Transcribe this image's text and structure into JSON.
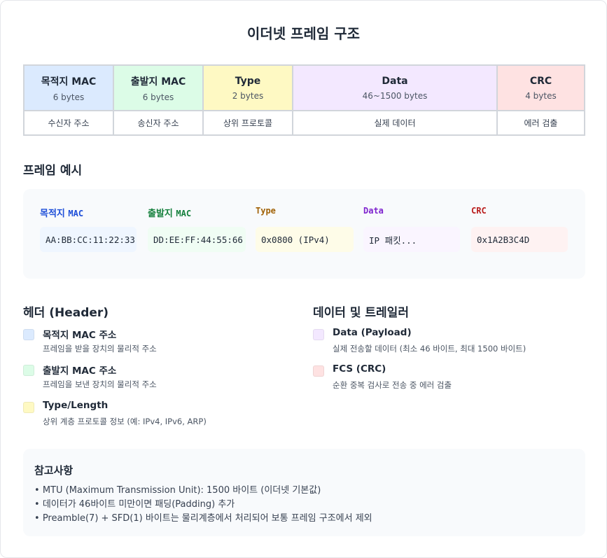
{
  "title": "이더넷 프레임 구조",
  "frame": [
    {
      "name": "목적지 MAC",
      "size": "6 bytes",
      "desc": "수신자 주소",
      "color": "#dbeafe"
    },
    {
      "name": "출발지 MAC",
      "size": "6 bytes",
      "desc": "송신자 주소",
      "color": "#dcfce7"
    },
    {
      "name": "Type",
      "size": "2 bytes",
      "desc": "상위 프로토콜",
      "color": "#fef9c3"
    },
    {
      "name": "Data",
      "size": "46~1500 bytes",
      "desc": "실제 데이터",
      "color": "#f3e8ff"
    },
    {
      "name": "CRC",
      "size": "4 bytes",
      "desc": "에러 검출",
      "color": "#fee2e2"
    }
  ],
  "example": {
    "title": "프레임 예시",
    "fields": [
      {
        "label": "목적지",
        "label_mono": "MAC",
        "value": "AA:BB:CC:11:22:33",
        "label_color": "#1d4ed8",
        "bg": "#eff6ff"
      },
      {
        "label": "출발지",
        "label_mono": "MAC",
        "value": "DD:EE:FF:44:55:66",
        "label_color": "#15803d",
        "bg": "#f0fdf4"
      },
      {
        "label": "",
        "label_mono": "Type",
        "value": "0x0800 (IPv4)",
        "label_color": "#a16207",
        "bg": "#fefce8"
      },
      {
        "label": "",
        "label_mono": "Data",
        "value": "IP 패킷...",
        "label_color": "#7e22ce",
        "bg": "#faf5ff"
      },
      {
        "label": "",
        "label_mono": "CRC",
        "value": "0x1A2B3C4D",
        "label_color": "#b91c1c",
        "bg": "#fef2f2"
      }
    ]
  },
  "legend_left": {
    "title": "헤더 (Header)",
    "items": [
      {
        "name": "목적지 MAC 주소",
        "desc": "프레임을 받을 장치의 물리적 주소",
        "color": "#dbeafe"
      },
      {
        "name": "출발지 MAC 주소",
        "desc": "프레임을 보낸 장치의 물리적 주소",
        "color": "#dcfce7"
      },
      {
        "name": "Type/Length",
        "desc": "상위 계층 프로토콜 정보 (예: IPv4, IPv6, ARP)",
        "color": "#fef9c3"
      }
    ]
  },
  "legend_right": {
    "title": "데이터 및 트레일러",
    "items": [
      {
        "name": "Data (Payload)",
        "desc": "실제 전송할 데이터 (최소 46 바이트, 최대 1500 바이트)",
        "color": "#f3e8ff"
      },
      {
        "name": "FCS (CRC)",
        "desc": "순환 중복 검사로 전송 중 에러 검출",
        "color": "#fee2e2"
      }
    ]
  },
  "notes": {
    "title": "참고사항",
    "items": [
      "MTU (Maximum Transmission Unit): 1500 바이트 (이더넷 기본값)",
      "데이터가 46바이트 미만이면 패딩(Padding) 추가",
      "Preamble(7) + SFD(1) 바이트는 물리계층에서 처리되어 보통 프레임 구조에서 제외"
    ]
  }
}
